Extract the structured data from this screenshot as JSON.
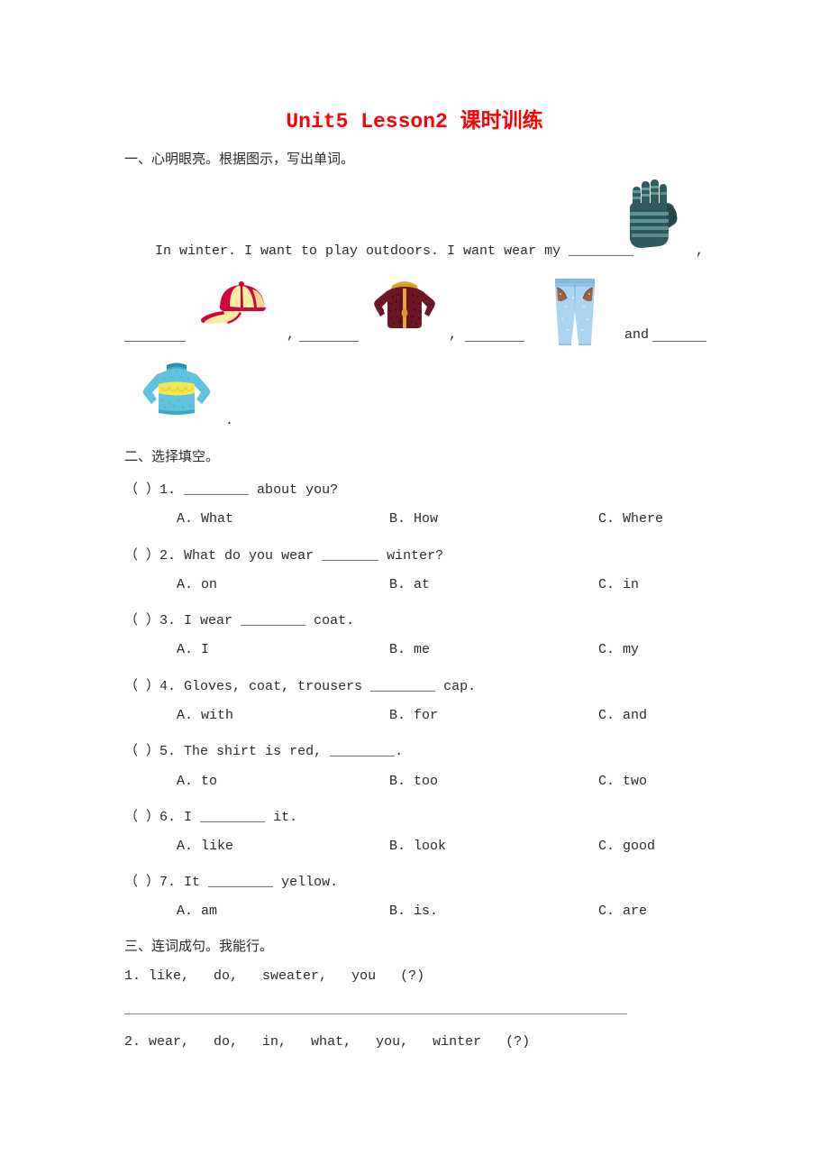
{
  "document": {
    "title_en": "Unit5 Lesson2 ",
    "title_cn": "课时训练",
    "title_color": "#ff0000"
  },
  "section_one": {
    "heading": "一、心明眼亮。根据图示，写出单词。",
    "sentence": "In winter. I want to play outdoors. I want wear my ________",
    "comma_after_glove": ",",
    "comma_1": ",",
    "comma_2": ",",
    "conjunction": "and",
    "final_period": ".",
    "images": [
      {
        "name": "glove",
        "alt": "gloves"
      },
      {
        "name": "cap",
        "alt": "cap"
      },
      {
        "name": "coat",
        "alt": "coat"
      },
      {
        "name": "trousers",
        "alt": "trousers"
      },
      {
        "name": "sweater",
        "alt": "sweater"
      }
    ]
  },
  "section_two": {
    "heading": "二、选择填空。",
    "questions": [
      {
        "marker": "（ ）",
        "number": "1.",
        "stem": "________ about you?",
        "options": [
          "A. What",
          "B. How",
          "C. Where"
        ]
      },
      {
        "marker": "（ ）",
        "number": "2.",
        "stem": "What do you wear _______ winter?",
        "options": [
          "A. on",
          "B. at",
          "C. in"
        ]
      },
      {
        "marker": "（ ）",
        "number": "3.",
        "stem": "I wear ________ coat.",
        "options": [
          "A. I",
          "B. me",
          "C. my"
        ]
      },
      {
        "marker": "（ ）",
        "number": "4.",
        "stem": "Gloves, coat, trousers ________ cap.",
        "options": [
          "A. with",
          "B. for",
          "C. and"
        ]
      },
      {
        "marker": "（ ）",
        "number": "5.",
        "stem": "The shirt is red, ________.",
        "options": [
          "A. to",
          "B. too",
          "C. two"
        ]
      },
      {
        "marker": "（ ）",
        "number": "6.",
        "stem": "I ________ it.",
        "options": [
          "A. like",
          "B. look",
          "C. good"
        ]
      },
      {
        "marker": "（ ）",
        "number": "7.",
        "stem": "It ________ yellow.",
        "options": [
          "A. am",
          "B. is.",
          "C. are"
        ]
      }
    ]
  },
  "section_three": {
    "heading": "三、连词成句。我能行。",
    "items": [
      {
        "number": "1.",
        "words": "like,   do,   sweater,   you   (?)"
      },
      {
        "number": "2.",
        "words": "wear,   do,   in,   what,   you,   winter   (?)"
      }
    ]
  }
}
